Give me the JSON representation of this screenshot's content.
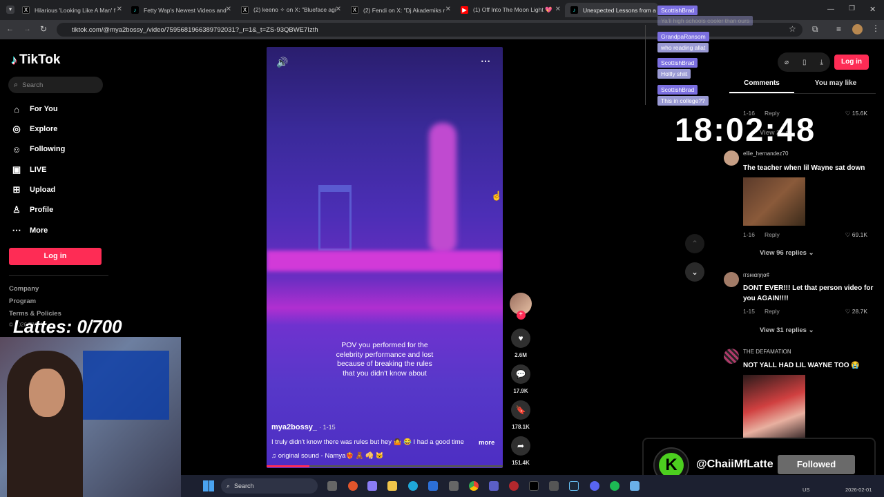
{
  "browser": {
    "tabs": [
      {
        "title": "Hilarious 'Looking Like A Man' f",
        "icon": "x-logo"
      },
      {
        "title": "Fetty Wap's Newest Videos and",
        "icon": "tiktok-logo"
      },
      {
        "title": "(2) keeno ✧ on X: \"Blueface agi",
        "icon": "x-logo"
      },
      {
        "title": "(2) Fendi on X: \"Dj Akademiks r",
        "icon": "x-logo"
      },
      {
        "title": "(1) Off Into The Moon Light 💖",
        "icon": "youtube-logo"
      },
      {
        "title": "Unexpected Lessons from a Ce",
        "icon": "tiktok-logo"
      }
    ],
    "url": "tiktok.com/@mya2bossy_/video/7595681966389792031?_r=1&_t=ZS-93QBWE7Izth"
  },
  "tiktok": {
    "logo": "TikTok",
    "search_placeholder": "Search",
    "nav": [
      "For You",
      "Explore",
      "Following",
      "LIVE",
      "Upload",
      "Profile",
      "More"
    ],
    "login_label": "Log in",
    "footer": [
      "Company",
      "Program",
      "Terms & Policies"
    ],
    "copyright": "© 2026 TikTok"
  },
  "video": {
    "caption_overlay": "POV you performed for the celebrity performance and lost because of breaking the rules that you didn't know about",
    "author": "mya2bossy_",
    "date": "· 1-15",
    "description": "I truly didn't know there was rules but hey 🤷 😂 I had a good time",
    "more": "more",
    "sound": "♫  original sound - Namya❤️‍🔥 🧸 🥠 🐱"
  },
  "actions": {
    "likes": "2.6M",
    "comments": "17.9K",
    "saves": "178.1K",
    "shares": "151.4K"
  },
  "panel": {
    "tabs": [
      "Comments",
      "You may like"
    ],
    "login_label": "Log in"
  },
  "comments": [
    {
      "meta_date": "1-16",
      "reply": "Reply",
      "likes": "15.6K",
      "partial": "View 26 re"
    },
    {
      "user": "ellie_hernandez70",
      "text": "The teacher when lil Wayne sat down",
      "date": "1-16",
      "reply": "Reply",
      "likes": "69.1K",
      "view_replies": "View 96 replies"
    },
    {
      "user": "ιтѕнιαηηα¢",
      "text": "DONT EVER!!! Let that person video for you AGAIN!!!!",
      "date": "1-15",
      "reply": "Reply",
      "likes": "28.7K",
      "view_replies": "View 31 replies"
    },
    {
      "user": "THE DEFAMATION",
      "text": "NOT YALL HAD LIL WAYNE TOO 😭"
    }
  ],
  "stream": {
    "lattes": "Lattes: 0/700",
    "clock": "18:02:48",
    "follow_user": "@ChaiiMfLatte",
    "follow_label": "Followed",
    "chat": [
      {
        "name": "ScottishBrad",
        "text": "Ya'll high schools cooler than ours"
      },
      {
        "name": "GrandpaRansom",
        "text": "who reading allat"
      },
      {
        "name": "ScottishBrad",
        "text": "Hollly shiit"
      },
      {
        "name": "ScottishBrad",
        "text": "This in college??"
      }
    ]
  },
  "taskbar": {
    "search": "Search",
    "date": "2026-02-01",
    "region": "US"
  },
  "colors": {
    "accent": "#fe2c55",
    "chat": "#7b6fe0",
    "follow_green": "#4ccf1f"
  }
}
